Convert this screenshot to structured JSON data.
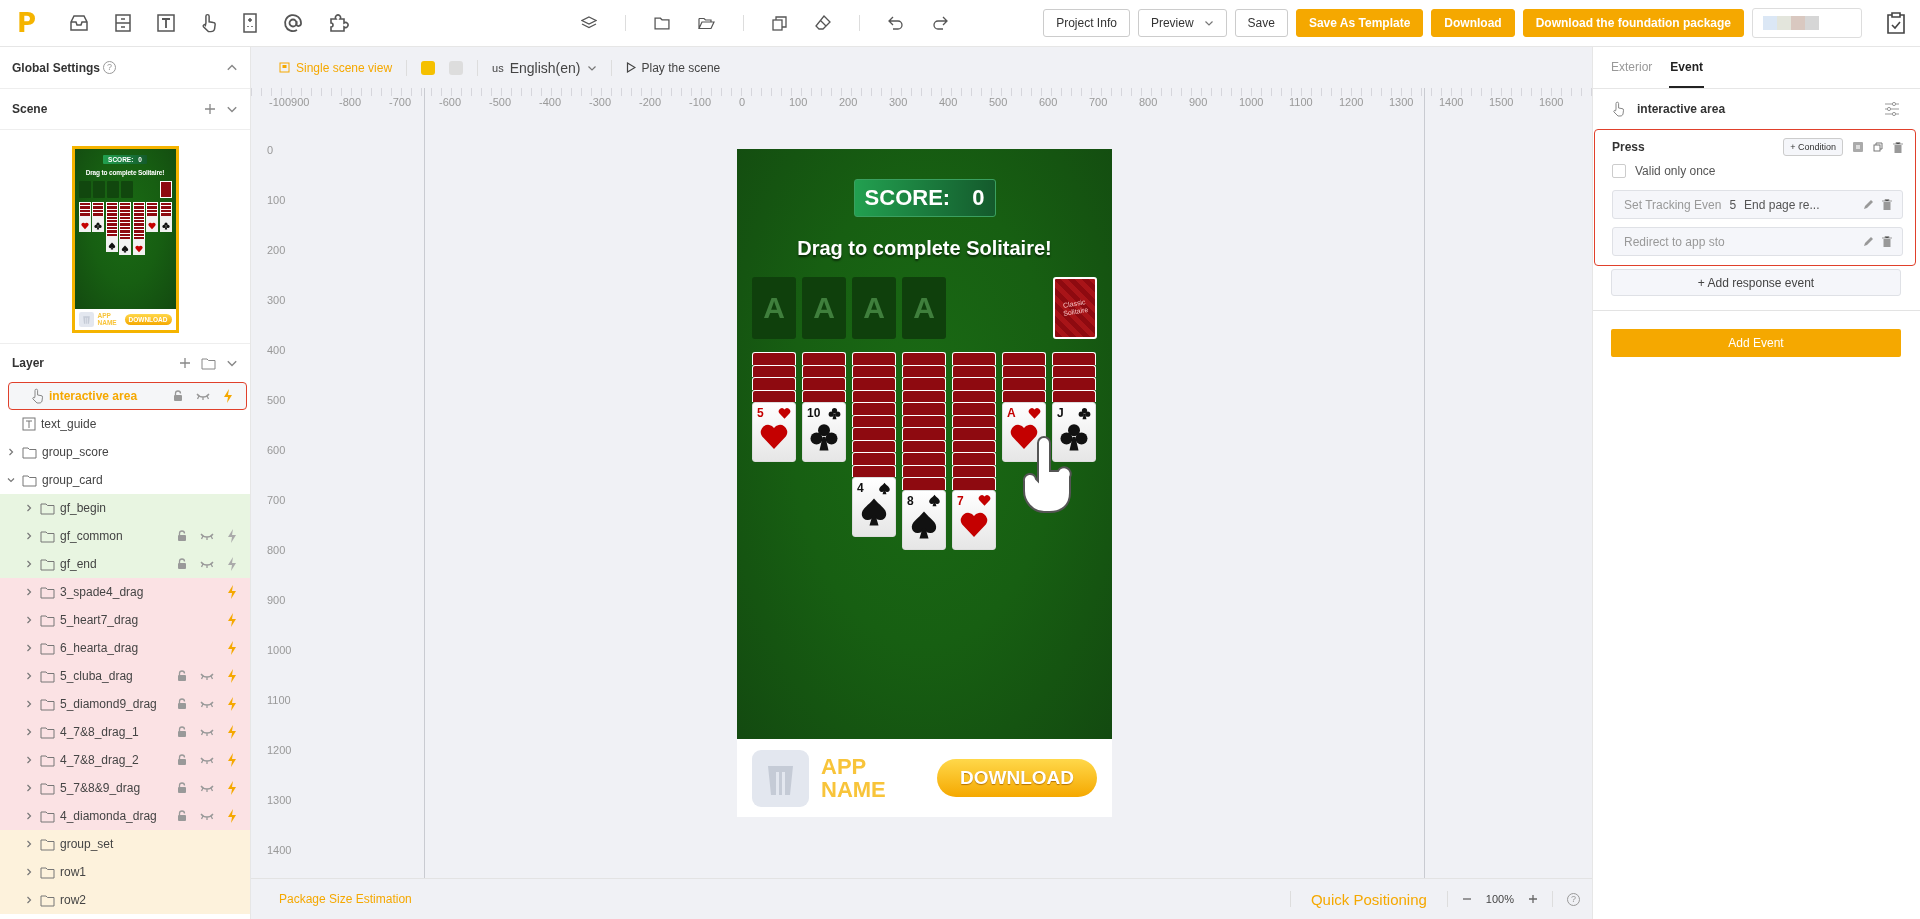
{
  "topbar": {
    "logo": "P",
    "buttons": [
      {
        "label": "Project Info",
        "kind": "plain"
      },
      {
        "label": "Preview",
        "kind": "dropdown"
      },
      {
        "label": "Save",
        "kind": "plain"
      },
      {
        "label": "Save As Template",
        "kind": "primary"
      },
      {
        "label": "Download",
        "kind": "primary"
      },
      {
        "label": "Download the foundation package",
        "kind": "primary"
      }
    ]
  },
  "left": {
    "global_settings": "Global Settings",
    "help": "?",
    "scene_title": "Scene",
    "layer_title": "Layer",
    "thumbnail": {
      "score_label": "SCORE:",
      "score": "0",
      "title": "Drag to complete Solitaire!",
      "tableau": [
        {
          "cards": [
            {
              "kind": "back"
            },
            {
              "kind": "back"
            },
            {
              "kind": "back"
            },
            {
              "kind": "back"
            },
            {
              "kind": "hearts"
            }
          ]
        },
        {
          "cards": [
            {
              "kind": "back"
            },
            {
              "kind": "back"
            },
            {
              "kind": "back"
            },
            {
              "kind": "back"
            },
            {
              "kind": "clubs"
            }
          ]
        },
        {
          "cards": [
            {
              "kind": "back"
            },
            {
              "kind": "back"
            },
            {
              "kind": "back"
            },
            {
              "kind": "back"
            },
            {
              "kind": "back"
            },
            {
              "kind": "back"
            },
            {
              "kind": "back"
            },
            {
              "kind": "back"
            },
            {
              "kind": "back"
            },
            {
              "kind": "back"
            },
            {
              "kind": "spades"
            }
          ]
        },
        {
          "cards": [
            {
              "kind": "back"
            },
            {
              "kind": "back"
            },
            {
              "kind": "back"
            },
            {
              "kind": "back"
            },
            {
              "kind": "back"
            },
            {
              "kind": "back"
            },
            {
              "kind": "back"
            },
            {
              "kind": "back"
            },
            {
              "kind": "back"
            },
            {
              "kind": "back"
            },
            {
              "kind": "back"
            },
            {
              "kind": "spades"
            }
          ]
        },
        {
          "cards": [
            {
              "kind": "back"
            },
            {
              "kind": "back"
            },
            {
              "kind": "back"
            },
            {
              "kind": "back"
            },
            {
              "kind": "back"
            },
            {
              "kind": "back"
            },
            {
              "kind": "back"
            },
            {
              "kind": "back"
            },
            {
              "kind": "back"
            },
            {
              "kind": "back"
            },
            {
              "kind": "back"
            },
            {
              "kind": "hearts"
            }
          ]
        },
        {
          "cards": [
            {
              "kind": "back"
            },
            {
              "kind": "back"
            },
            {
              "kind": "back"
            },
            {
              "kind": "back"
            },
            {
              "kind": "hearts"
            }
          ]
        },
        {
          "cards": [
            {
              "kind": "back"
            },
            {
              "kind": "back"
            },
            {
              "kind": "back"
            },
            {
              "kind": "back"
            },
            {
              "kind": "clubs"
            }
          ]
        }
      ],
      "app_name": "APP NAME",
      "download": "DOWNLOAD"
    },
    "layers": [
      {
        "name": "interactive area",
        "kind": "touch",
        "selected": true,
        "locked": true,
        "hidden": true,
        "has_event": true,
        "event_enabled": true
      },
      {
        "name": "text_guide",
        "kind": "text",
        "selected": false
      },
      {
        "name": "group_score",
        "kind": "folder",
        "selected": false,
        "expanded": false
      },
      {
        "name": "group_card",
        "kind": "folder",
        "selected": false,
        "expanded": true,
        "children": [
          {
            "name": "gf_begin",
            "kind": "folder",
            "selected": false,
            "expanded": false,
            "color": "#e8f5e1"
          },
          {
            "name": "gf_common",
            "kind": "folder",
            "selected": false,
            "expanded": false,
            "color": "#e8f5e1",
            "locked": true,
            "hidden": true,
            "has_event": true,
            "event_enabled": false
          },
          {
            "name": "gf_end",
            "kind": "folder",
            "selected": false,
            "expanded": false,
            "color": "#e8f5e1",
            "locked": true,
            "hidden": true,
            "has_event": true,
            "event_enabled": false
          },
          {
            "name": "3_spade4_drag",
            "kind": "folder",
            "selected": false,
            "expanded": false,
            "color": "#fbe2e4",
            "has_event": true,
            "event_enabled": true
          },
          {
            "name": "5_heart7_drag",
            "kind": "folder",
            "selected": false,
            "expanded": false,
            "color": "#fbe2e4",
            "has_event": true,
            "event_enabled": true
          },
          {
            "name": "6_hearta_drag",
            "kind": "folder",
            "selected": false,
            "expanded": false,
            "color": "#fbe2e4",
            "has_event": true,
            "event_enabled": true
          },
          {
            "name": "5_cluba_drag",
            "kind": "folder",
            "selected": false,
            "expanded": false,
            "color": "#fbe2e4",
            "locked": true,
            "hidden": true,
            "has_event": true,
            "event_enabled": true
          },
          {
            "name": "5_diamond9_drag",
            "kind": "folder",
            "selected": false,
            "expanded": false,
            "color": "#fbe2e4",
            "locked": true,
            "hidden": true,
            "has_event": true,
            "event_enabled": true
          },
          {
            "name": "4_7&8_drag_1",
            "kind": "folder",
            "selected": false,
            "expanded": false,
            "color": "#fbe2e4",
            "locked": true,
            "hidden": true,
            "has_event": true,
            "event_enabled": true
          },
          {
            "name": "4_7&8_drag_2",
            "kind": "folder",
            "selected": false,
            "expanded": false,
            "color": "#fbe2e4",
            "locked": true,
            "hidden": true,
            "has_event": true,
            "event_enabled": true
          },
          {
            "name": "5_7&8&9_drag",
            "kind": "folder",
            "selected": false,
            "expanded": false,
            "color": "#fbe2e4",
            "locked": true,
            "hidden": true,
            "has_event": true,
            "event_enabled": true
          },
          {
            "name": "4_diamonda_drag",
            "kind": "folder",
            "selected": false,
            "expanded": false,
            "color": "#fbe2e4",
            "locked": true,
            "hidden": true,
            "has_event": true,
            "event_enabled": true
          },
          {
            "name": "group_set",
            "kind": "folder",
            "selected": false,
            "expanded": false,
            "color": "#fdf2dc"
          },
          {
            "name": "row1",
            "kind": "folder",
            "selected": false,
            "expanded": false,
            "color": "#fdf2dc"
          },
          {
            "name": "row2",
            "kind": "folder",
            "selected": false,
            "expanded": false,
            "color": "#fdf2dc"
          }
        ]
      }
    ]
  },
  "canvas_toolbar": {
    "scene_view": {
      "label": "Single scene view",
      "active": true
    },
    "device_toggles": [
      {
        "selected": true
      },
      {
        "selected": false
      }
    ],
    "flag": "us",
    "language": "English(en)",
    "play": "Play the scene"
  },
  "ruler": {
    "x_labels": [
      "-100900",
      "-800",
      "-700",
      "-600",
      "-500",
      "-400",
      "-300",
      "-200",
      "-100",
      "0",
      "100",
      "200",
      "300",
      "400",
      "500",
      "600",
      "700",
      "800",
      "900",
      "1000",
      "1100",
      "1200",
      "1300",
      "1400",
      "1500",
      "1600"
    ],
    "y_labels": [
      "0",
      "100",
      "200",
      "300",
      "400",
      "500",
      "600",
      "700",
      "800",
      "900",
      "1000",
      "1100",
      "1200",
      "1300",
      "1400"
    ]
  },
  "phone": {
    "score_label": "SCORE:",
    "score": "0",
    "title": "Drag to complete Solitaire!",
    "foundations": [
      "A",
      "A",
      "A",
      "A"
    ],
    "stock_label": "Classic Solitaire",
    "tableau": [
      {
        "cards": [
          {
            "kind": "back"
          },
          {
            "kind": "back"
          },
          {
            "kind": "back"
          },
          {
            "kind": "back"
          },
          {
            "kind": "hearts",
            "rank": "5"
          }
        ]
      },
      {
        "cards": [
          {
            "kind": "back"
          },
          {
            "kind": "back"
          },
          {
            "kind": "back"
          },
          {
            "kind": "back"
          },
          {
            "kind": "clubs",
            "rank": "10"
          }
        ]
      },
      {
        "cards": [
          {
            "kind": "back"
          },
          {
            "kind": "back"
          },
          {
            "kind": "back"
          },
          {
            "kind": "back"
          },
          {
            "kind": "back"
          },
          {
            "kind": "back"
          },
          {
            "kind": "back"
          },
          {
            "kind": "back"
          },
          {
            "kind": "back"
          },
          {
            "kind": "back"
          },
          {
            "kind": "spades",
            "rank": "4"
          }
        ]
      },
      {
        "cards": [
          {
            "kind": "back"
          },
          {
            "kind": "back"
          },
          {
            "kind": "back"
          },
          {
            "kind": "back"
          },
          {
            "kind": "back"
          },
          {
            "kind": "back"
          },
          {
            "kind": "back"
          },
          {
            "kind": "back"
          },
          {
            "kind": "back"
          },
          {
            "kind": "back"
          },
          {
            "kind": "back"
          },
          {
            "kind": "spades",
            "rank": "8"
          }
        ]
      },
      {
        "cards": [
          {
            "kind": "back"
          },
          {
            "kind": "back"
          },
          {
            "kind": "back"
          },
          {
            "kind": "back"
          },
          {
            "kind": "back"
          },
          {
            "kind": "back"
          },
          {
            "kind": "back"
          },
          {
            "kind": "back"
          },
          {
            "kind": "back"
          },
          {
            "kind": "back"
          },
          {
            "kind": "back"
          },
          {
            "kind": "hearts",
            "rank": "7"
          }
        ]
      },
      {
        "cards": [
          {
            "kind": "back"
          },
          {
            "kind": "back"
          },
          {
            "kind": "back"
          },
          {
            "kind": "back"
          },
          {
            "kind": "hearts",
            "rank": "A"
          }
        ]
      },
      {
        "cards": [
          {
            "kind": "back"
          },
          {
            "kind": "back"
          },
          {
            "kind": "back"
          },
          {
            "kind": "back"
          },
          {
            "kind": "clubs",
            "rank": "J"
          }
        ]
      }
    ],
    "app_name": "APP NAME",
    "download": "DOWNLOAD"
  },
  "bottom_bar": {
    "package_size": "Package Size Estimation",
    "quick_positioning": "Quick Positioning",
    "zoom": "100%",
    "help": "?"
  },
  "right": {
    "tabs": [
      {
        "label": "Exterior",
        "selected": false
      },
      {
        "label": "Event",
        "selected": true
      }
    ],
    "layer_name": "interactive area",
    "event": {
      "trigger": "Press",
      "condition": "+ Condition",
      "once": {
        "label": "Valid only once",
        "checked": false
      },
      "actions": [
        {
          "texts": [
            "Set Tracking Even",
            "5",
            "End page re..."
          ]
        },
        {
          "texts": [
            "Redirect to app sto"
          ]
        }
      ],
      "add_response": "+ Add response event"
    },
    "add_event": "Add Event"
  }
}
